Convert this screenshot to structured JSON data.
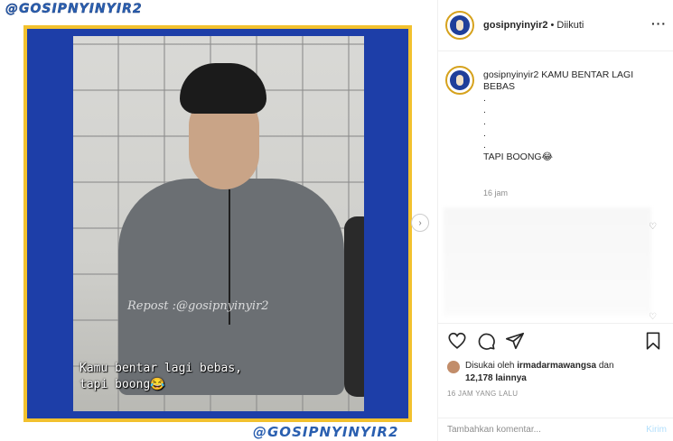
{
  "media": {
    "watermark_top": "@GOSIPNYINYIR2",
    "watermark_bottom": "@GOSIPNYINYIR2",
    "repost_text": "Repost :@gosipnyinyir2",
    "caption_line1": "Kamu bentar lagi bebas,",
    "caption_line2": "tapi boong😂",
    "next_icon": "chevron-right-icon"
  },
  "header": {
    "username": "gosipnyinyir2",
    "separator": "•",
    "follow_status": "Diikuti",
    "more": "···"
  },
  "caption": {
    "username": "gosipnyinyir2",
    "lines": [
      "KAMU BENTAR LAGI",
      "BEBAS",
      ".",
      ".",
      ".",
      ".",
      ".",
      "TAPI BOONG😂"
    ],
    "time": "16 jam"
  },
  "likes": {
    "prefix": "Disukai oleh",
    "user": "irmadarmawangsa",
    "and": "dan",
    "count": "12,178 lainnya"
  },
  "posted_ago": "16 JAM YANG LALU",
  "comment_box": {
    "placeholder": "Tambahkan komentar...",
    "send_label": "Kirim"
  },
  "colors": {
    "frame_blue": "#1d3ea8",
    "frame_yellow": "#f2c12e",
    "watermark": "#2a5fb0",
    "send_disabled": "#b2dffc"
  }
}
